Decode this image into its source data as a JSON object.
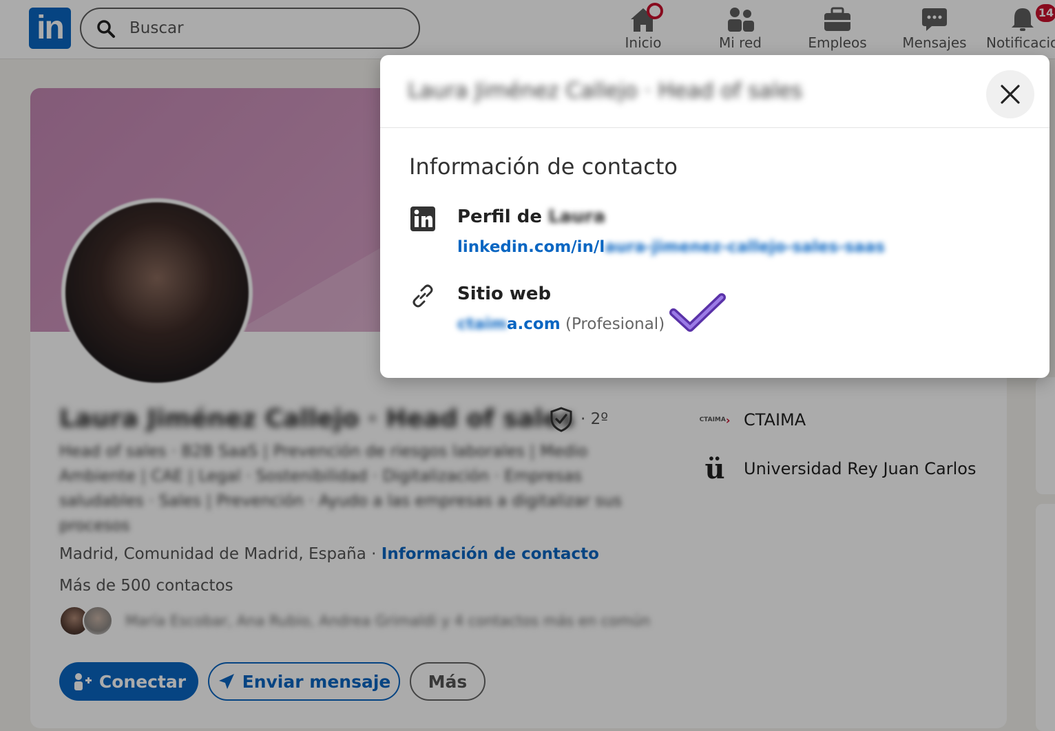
{
  "nav": {
    "logo_text": "in",
    "search_placeholder": "Buscar",
    "items": [
      {
        "label": "Inicio",
        "icon": "home-icon"
      },
      {
        "label": "Mi red",
        "icon": "network-icon"
      },
      {
        "label": "Empleos",
        "icon": "briefcase-icon"
      },
      {
        "label": "Mensajes",
        "icon": "messages-icon"
      },
      {
        "label": "Notificacio",
        "icon": "bell-icon",
        "badge": "14"
      }
    ]
  },
  "profile": {
    "name": "Laura Jiménez Callejo · Head of sales",
    "degree": "· 2º",
    "headline": "Head of sales · B2B SaaS | Prevención de riesgos laborales | Medio Ambiente | CAE | Legal · Sostenibilidad · Digitalización · Empresas saludables · Sales | Prevención · Ayudo a las empresas a digitalizar sus procesos",
    "location": "Madrid, Comunidad de Madrid, España",
    "location_separator": " · ",
    "contact_info_link": "Información de contacto",
    "contacts": "Más de 500 contactos",
    "mutual_text": "María Escobar, Ana Rubio, Andrea Grimaldi y 4 contactos más en común",
    "companies": [
      {
        "logo_text": "CTAIMA",
        "name": "CTAIMA"
      },
      {
        "logo_text": "ü",
        "name": "Universidad Rey Juan Carlos"
      }
    ],
    "buttons": {
      "connect": "Conectar",
      "message": "Enviar mensaje",
      "more": "Más"
    }
  },
  "modal": {
    "title": "Laura Jiménez Callejo · Head of sales",
    "section_title": "Información de contacto",
    "profile_label_prefix": "Perfil de ",
    "profile_label_name": "Laura",
    "profile_url_prefix": "linkedin.com/in/l",
    "profile_url_hidden": "aura-jimenez-callejo-sales-saas",
    "website_label": "Sitio web",
    "website_hidden": "ctaim",
    "website_suffix": "a.com",
    "website_type": " (Profesional)"
  },
  "colors": {
    "brand": "#0a66c2",
    "badge": "#cb112d",
    "checkmark": "#7b4fd4"
  }
}
